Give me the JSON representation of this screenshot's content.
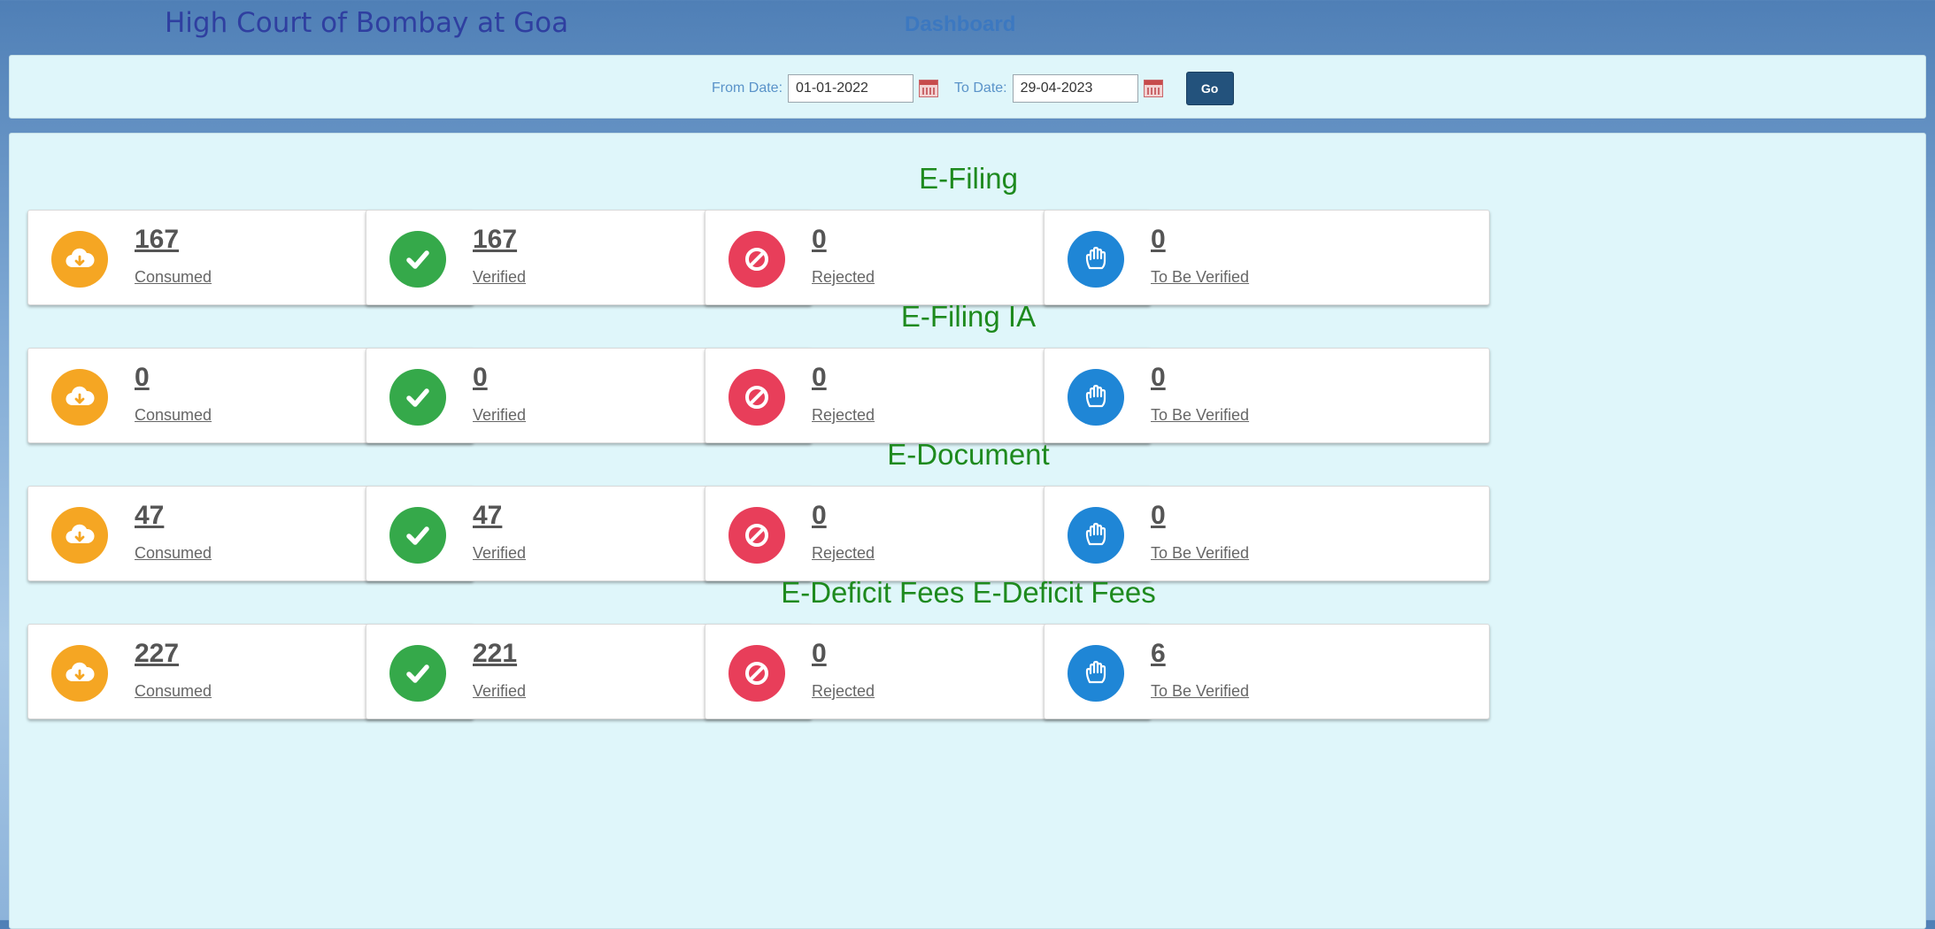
{
  "header": {
    "court_title": "High Court of Bombay at Goa",
    "dashboard_title": "Dashboard"
  },
  "filter": {
    "from_label": "From Date:",
    "from_value": "01-01-2022",
    "to_label": "To Date:",
    "to_value": "29-04-2023",
    "go_label": "Go"
  },
  "sections": [
    {
      "title": "E-Filing",
      "cards": [
        {
          "count": "167",
          "label": "Consumed",
          "icon": "cloud-download-icon",
          "color": "#f5a623"
        },
        {
          "count": "167",
          "label": "Verified",
          "icon": "check-icon",
          "color": "#35a94a"
        },
        {
          "count": "0",
          "label": "Rejected",
          "icon": "ban-icon",
          "color": "#e83e5a"
        },
        {
          "count": "0",
          "label": "To Be Verified",
          "icon": "hand-icon",
          "color": "#1f86d6"
        }
      ]
    },
    {
      "title": "E-Filing IA",
      "cards": [
        {
          "count": "0",
          "label": "Consumed",
          "icon": "cloud-download-icon",
          "color": "#f5a623"
        },
        {
          "count": "0",
          "label": "Verified",
          "icon": "check-icon",
          "color": "#35a94a"
        },
        {
          "count": "0",
          "label": "Rejected",
          "icon": "ban-icon",
          "color": "#e83e5a"
        },
        {
          "count": "0",
          "label": "To Be Verified",
          "icon": "hand-icon",
          "color": "#1f86d6"
        }
      ]
    },
    {
      "title": "E-Document",
      "cards": [
        {
          "count": "47",
          "label": "Consumed",
          "icon": "cloud-download-icon",
          "color": "#f5a623"
        },
        {
          "count": "47",
          "label": "Verified",
          "icon": "check-icon",
          "color": "#35a94a"
        },
        {
          "count": "0",
          "label": "Rejected",
          "icon": "ban-icon",
          "color": "#e83e5a"
        },
        {
          "count": "0",
          "label": "To Be Verified",
          "icon": "hand-icon",
          "color": "#1f86d6"
        }
      ]
    },
    {
      "title": "E-Deficit Fees E-Deficit Fees",
      "cards": [
        {
          "count": "227",
          "label": "Consumed",
          "icon": "cloud-download-icon",
          "color": "#f5a623"
        },
        {
          "count": "221",
          "label": "Verified",
          "icon": "check-icon",
          "color": "#35a94a"
        },
        {
          "count": "0",
          "label": "Rejected",
          "icon": "ban-icon",
          "color": "#e83e5a"
        },
        {
          "count": "6",
          "label": "To Be Verified",
          "icon": "hand-icon",
          "color": "#1f86d6"
        }
      ]
    }
  ]
}
